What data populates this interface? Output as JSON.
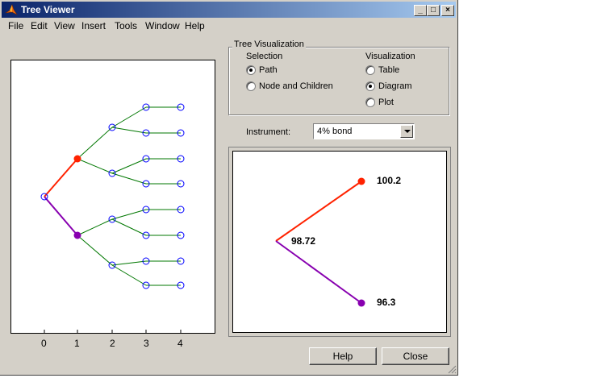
{
  "window": {
    "title": "Tree Viewer",
    "icon": "matlab-icon"
  },
  "titlebar_buttons": {
    "minimize": "_",
    "maximize": "□",
    "close": "×"
  },
  "menu": [
    "File",
    "Edit",
    "View",
    "Insert",
    "Tools",
    "Window",
    "Help"
  ],
  "tree_axes": {
    "xticks": [
      "0",
      "1",
      "2",
      "3",
      "4"
    ]
  },
  "visualization_panel": {
    "title": "Tree Visualization",
    "selection": {
      "heading": "Selection",
      "options": [
        "Path",
        "Node and Children"
      ],
      "selected": "Path"
    },
    "visualization": {
      "heading": "Visualization",
      "options": [
        "Table",
        "Diagram",
        "Plot"
      ],
      "selected": "Diagram"
    }
  },
  "instrument": {
    "label": "Instrument:",
    "value": "4% bond"
  },
  "diagram": {
    "root": "98.72",
    "up": "100.2",
    "down": "96.3"
  },
  "buttons": {
    "help": "Help",
    "close": "Close"
  },
  "colors": {
    "up_path": "#ff2200",
    "down_path": "#8800b0",
    "tree_edges": "#007700",
    "tree_nodes": "#0000ff"
  }
}
